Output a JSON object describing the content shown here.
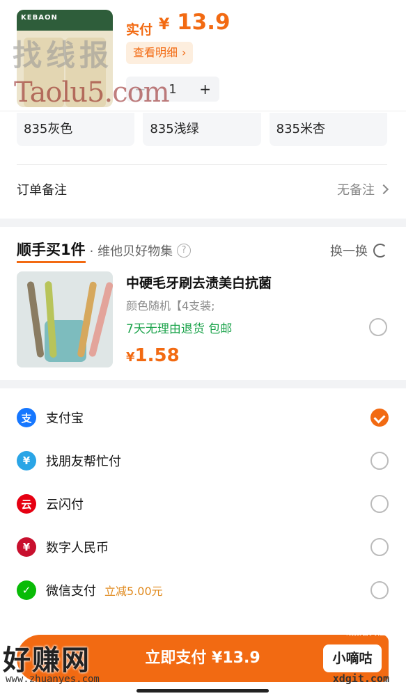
{
  "product": {
    "thumb_brand": "KEBAON",
    "price_label": "实付",
    "price_currency": "¥",
    "price_value": "13.9",
    "detail_link": "查看明细",
    "quantity": "1",
    "minus": "−",
    "plus": "+"
  },
  "variants": [
    "835灰色",
    "835浅绿",
    "835米杏"
  ],
  "remark": {
    "label": "订单备注",
    "value": "无备注"
  },
  "addon": {
    "brand": "顺手买1件",
    "sub": "· 维他贝好物集",
    "help": "?",
    "swap": "换一换",
    "name": "中硬毛牙刷去渍美白抗菌",
    "spec": "颜色随机【4支装;",
    "tags": "7天无理由退货  包邮",
    "price_currency": "¥",
    "price": "1.58"
  },
  "payments": [
    {
      "label": "支付宝",
      "icon": "alipay-icon",
      "color": "#1677ff",
      "glyph": "支",
      "checked": true,
      "promo": ""
    },
    {
      "label": "找朋友帮忙付",
      "icon": "friend-pay-icon",
      "color": "#2aa5e6",
      "glyph": "¥",
      "checked": false,
      "promo": ""
    },
    {
      "label": "云闪付",
      "icon": "unionpay-icon",
      "color": "#e60012",
      "glyph": "云",
      "checked": false,
      "promo": ""
    },
    {
      "label": "数字人民币",
      "icon": "ecny-icon",
      "color": "#c8102e",
      "glyph": "¥",
      "checked": false,
      "promo": ""
    },
    {
      "label": "微信支付",
      "icon": "wechat-pay-icon",
      "color": "#09bb07",
      "glyph": "✓",
      "checked": false,
      "promo": "立减5.00元"
    }
  ],
  "paybar": {
    "label": "立即支付 ¥13.9",
    "badge": "小嘀咕"
  },
  "watermarks": {
    "top_cn": "找线报",
    "top_en": "Taolu5.com",
    "bottom_cn": "好赚网",
    "bottom_url": "www.zhuanyes.com",
    "bottom_right": "xdgit.com",
    "tiny": "线报音关社区"
  }
}
